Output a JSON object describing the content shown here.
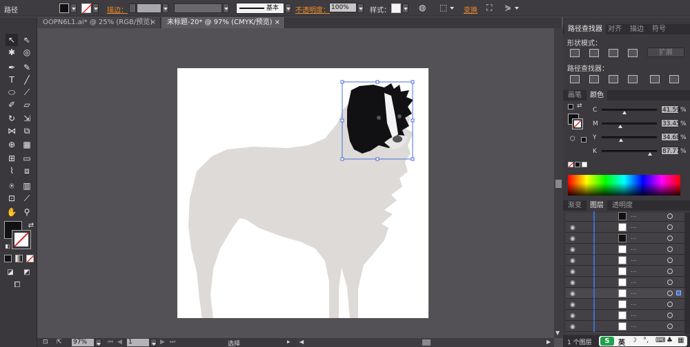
{
  "control_bar": {
    "selection_type": "路径",
    "stroke_label": "描边：",
    "style_line_label": "基本",
    "opacity_label": "不透明度：",
    "opacity_value": "100%",
    "style_label": "样式：",
    "transform_label": "变换"
  },
  "tabs": [
    {
      "label": "OOPN6L1.ai* @ 25% (RGB/预览)"
    },
    {
      "label": "未标题-20* @ 97% (CMYK/预览)"
    }
  ],
  "status": {
    "zoom": "97%",
    "artboard": "1",
    "tool_label": "选择"
  },
  "pathfinder": {
    "tabs": [
      "路径查找器",
      "对齐",
      "描边",
      "符号"
    ],
    "shape_modes_label": "形状模式：",
    "expand_label": "扩展",
    "pathfinders_label": "路径查找器："
  },
  "color_panel": {
    "tabs": [
      "画笔",
      "颜色"
    ],
    "channels": [
      {
        "label": "C",
        "value": "41.59",
        "fraction": 0.416
      },
      {
        "label": "M",
        "value": "33.45",
        "fraction": 0.335
      },
      {
        "label": "Y",
        "value": "34.68",
        "fraction": 0.347
      },
      {
        "label": "K",
        "value": "87.77",
        "fraction": 0.878
      }
    ],
    "percent_sign": "%"
  },
  "layers_panel": {
    "tabs": [
      "渐变",
      "图层",
      "透明度"
    ],
    "row_dots": "...",
    "footer_label": "1 个图层"
  },
  "ime": {
    "lang": "英"
  },
  "colors": {
    "fur": "#dddad8",
    "head": "#111013",
    "selection": "#4a6ed8"
  }
}
